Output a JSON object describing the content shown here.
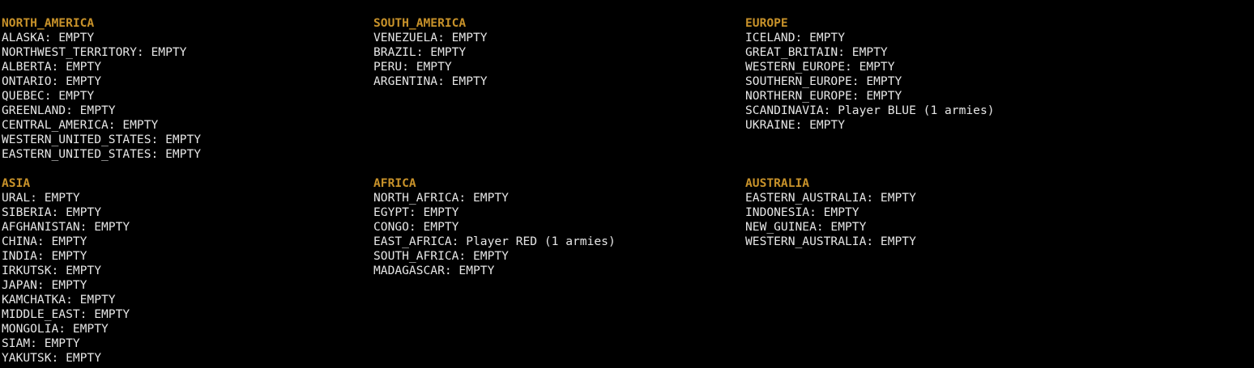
{
  "continents": [
    {
      "name": "NORTH_AMERICA",
      "territories": [
        "ALASKA: EMPTY",
        "NORTHWEST_TERRITORY: EMPTY",
        "ALBERTA: EMPTY",
        "ONTARIO: EMPTY",
        "QUEBEC: EMPTY",
        "GREENLAND: EMPTY",
        "CENTRAL_AMERICA: EMPTY",
        "WESTERN_UNITED_STATES: EMPTY",
        "EASTERN_UNITED_STATES: EMPTY"
      ]
    },
    {
      "name": "SOUTH_AMERICA",
      "territories": [
        "VENEZUELA: EMPTY",
        "BRAZIL: EMPTY",
        "PERU: EMPTY",
        "ARGENTINA: EMPTY"
      ]
    },
    {
      "name": "EUROPE",
      "territories": [
        "ICELAND: EMPTY",
        "GREAT_BRITAIN: EMPTY",
        "WESTERN_EUROPE: EMPTY",
        "SOUTHERN_EUROPE: EMPTY",
        "NORTHERN_EUROPE: EMPTY",
        "SCANDINAVIA: Player BLUE (1 armies)",
        "UKRAINE: EMPTY"
      ]
    },
    {
      "name": "ASIA",
      "territories": [
        "URAL: EMPTY",
        "SIBERIA: EMPTY",
        "AFGHANISTAN: EMPTY",
        "CHINA: EMPTY",
        "INDIA: EMPTY",
        "IRKUTSK: EMPTY",
        "JAPAN: EMPTY",
        "KAMCHATKA: EMPTY",
        "MIDDLE_EAST: EMPTY",
        "MONGOLIA: EMPTY",
        "SIAM: EMPTY",
        "YAKUTSK: EMPTY"
      ]
    },
    {
      "name": "AFRICA",
      "territories": [
        "NORTH_AFRICA: EMPTY",
        "EGYPT: EMPTY",
        "CONGO: EMPTY",
        "EAST_AFRICA: Player RED (1 armies)",
        "SOUTH_AFRICA: EMPTY",
        "MADAGASCAR: EMPTY"
      ]
    },
    {
      "name": "AUSTRALIA",
      "territories": [
        "EASTERN_AUSTRALIA: EMPTY",
        "INDONESIA: EMPTY",
        "NEW_GUINEA: EMPTY",
        "WESTERN_AUSTRALIA: EMPTY"
      ]
    }
  ],
  "colors": {
    "background": "#000000",
    "heading": "#c8922a",
    "text": "#e6e6e6"
  }
}
